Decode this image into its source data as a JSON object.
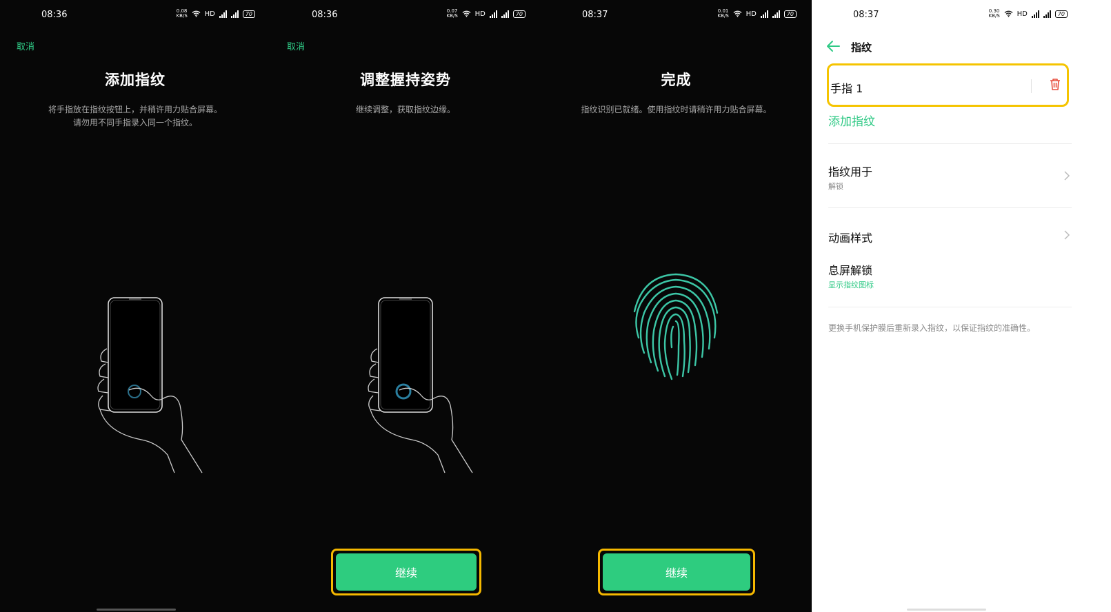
{
  "colors": {
    "accent": "#2ecc7f",
    "highlight": "#f5b800",
    "delete": "#e74c3c"
  },
  "screens": [
    {
      "time": "08:36",
      "net_speed": "0.08",
      "net_unit": "KB/S",
      "hd": "HD",
      "battery": "70",
      "cancel": "取消",
      "title": "添加指纹",
      "description": "将手指放在指纹按钮上，并稍许用力贴合屏幕。\n请勿用不同手指录入同一个指纹。",
      "illustration": "hand-holding-phone-icon"
    },
    {
      "time": "08:36",
      "net_speed": "0.07",
      "net_unit": "KB/S",
      "hd": "HD",
      "battery": "70",
      "cancel": "取消",
      "title": "调整握持姿势",
      "description": "继续调整，获取指纹边缘。",
      "illustration": "hand-holding-phone-icon",
      "button": "继续"
    },
    {
      "time": "08:37",
      "net_speed": "0.01",
      "net_unit": "KB/S",
      "hd": "HD",
      "battery": "70",
      "title": "完成",
      "description": "指纹识别已就绪。使用指纹时请稍许用力贴合屏幕。",
      "illustration": "fingerprint-icon",
      "button": "继续"
    },
    {
      "time": "08:37",
      "net_speed": "0.30",
      "net_unit": "KB/S",
      "hd": "HD",
      "battery": "70",
      "page_title": "指纹",
      "finger_item": "手指 1",
      "add_fingerprint": "添加指纹",
      "rows": [
        {
          "title": "指纹用于",
          "subtitle": "解锁"
        },
        {
          "title": "动画样式"
        },
        {
          "title": "息屏解锁",
          "subtitle": "显示指纹图标"
        }
      ],
      "note": "更换手机保护膜后重新录入指纹，以保证指纹的准确性。"
    }
  ]
}
